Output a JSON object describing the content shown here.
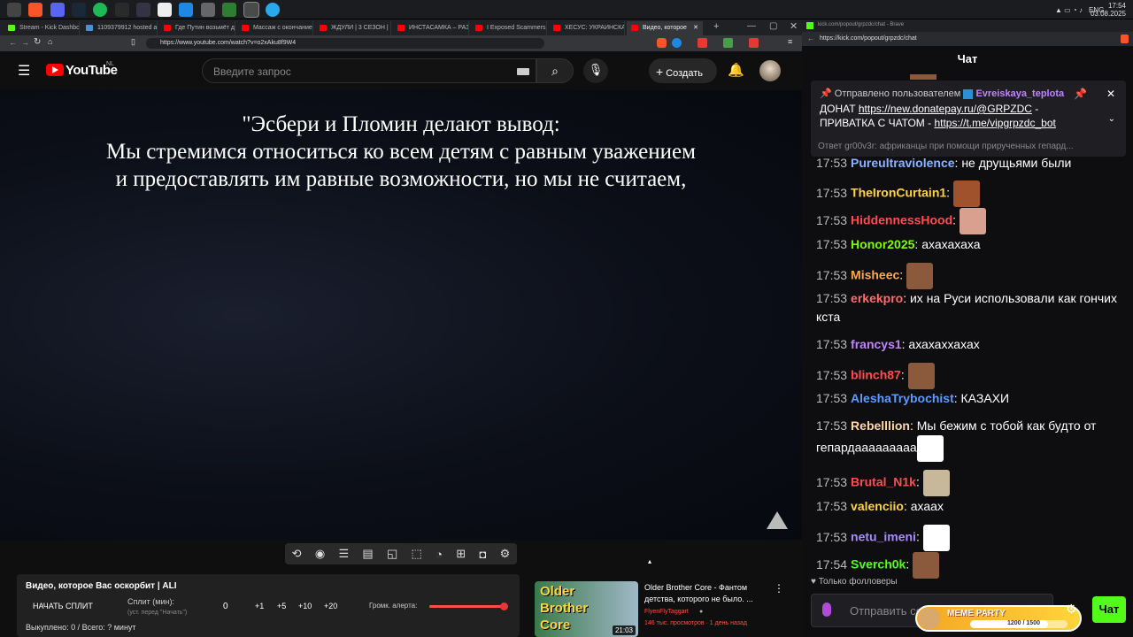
{
  "system": {
    "lang": "ENG",
    "time": "17:54",
    "date": "03.08.2025"
  },
  "browser_left": {
    "tabs": [
      {
        "label": "Stream - Kick Dashboard",
        "color": "#53fc18"
      },
      {
        "label": "1109379912 hosted at Im",
        "color": "#4a90d9"
      },
      {
        "label": "Где Путин возьмёт деньги",
        "color": "#ff0000"
      },
      {
        "label": "Массаж с окончанием",
        "color": "#ff0000"
      },
      {
        "label": "ЖДУЛИ | 3 СЕЗОН | 8 В",
        "color": "#ff0000"
      },
      {
        "label": "ИНСТАСАМКА – РАЗОБ",
        "color": "#ff0000"
      },
      {
        "label": "I Exposed Scammers in",
        "color": "#ff0000"
      },
      {
        "label": "ХЕСУС: УКРАИНСКАЯ (",
        "color": "#ff0000"
      },
      {
        "label": "Видео, которое",
        "color": "#ff0000"
      }
    ],
    "url": "https://www.youtube.com/watch?v=o2xAku8f9W4"
  },
  "youtube": {
    "logo": "YouTube",
    "region": "NL",
    "search_placeholder": "Введите запрос",
    "create_label": "Создать",
    "subtitles": [
      "\"Эсбери и Пломин делают вывод:",
      "Мы стремимся относиться ко всем детям с равным уважением",
      "и предоставлять им равные возможности, но мы не считаем,"
    ]
  },
  "alert_panel": {
    "title": "Видео, которое Вас оскорбит | ALI",
    "start_split": "НАЧАТЬ СПЛИТ",
    "split_label": "Сплит (мин):",
    "split_hint": "(уст. перед \"Начать\")",
    "split_value": "0",
    "increments": [
      "+1",
      "+5",
      "+10",
      "+20"
    ],
    "volume_label": "Громк. алерта:",
    "volume": 0.97,
    "bought": "Выкуплено: 0 / Всего: ? минут"
  },
  "recommendation": {
    "thumb_text": "Older Brother Core",
    "duration": "21:03",
    "title": "Older Brother Core - Фантом детства, которого не было. ...",
    "channel": "FlyenFlyTaggart",
    "meta": "146 тыс. просмотров · 1 день назад"
  },
  "browser_right": {
    "title": "kick.com/popout/grpzdc/chat - Brave",
    "url": "https://kick.com/popout/grpzdc/chat"
  },
  "chat": {
    "header": "Чат",
    "pinned": {
      "prefix": "Отправлено пользователем",
      "user": "Evreiskaya_teplota",
      "line1a": "ДОНАТ ",
      "link1": "https://new.donatepay.ru/@GRPZDC",
      "line1b": " -",
      "line2a": "ПРИВАТКА С ЧАТОМ - ",
      "link2": "https://t.me/vipgrpzdc_bot"
    },
    "reply_preview": "Ответ gr00v3r: африканцы при помощи прирученных гепард...",
    "messages": [
      {
        "time": "17:53",
        "user": "Pureultraviolence",
        "color": "#8ab4ff",
        "text": "не друщьями были",
        "emote": ""
      },
      {
        "time": "17:53",
        "user": "TheIronCurtain1",
        "color": "#ffd43b",
        "text": "",
        "emote": "#a0522d"
      },
      {
        "time": "17:53",
        "user": "HiddennessHood",
        "color": "#ff4d4d",
        "text": "",
        "emote": "#d9a090"
      },
      {
        "time": "17:53",
        "user": "Honor2025",
        "color": "#7cfc00",
        "text": "ахахахаха",
        "emote": ""
      },
      {
        "time": "17:53",
        "user": "Misheec",
        "color": "#ffa94d",
        "text": "",
        "emote": "#8b5a3c"
      },
      {
        "time": "17:53",
        "user": "erkekpro",
        "color": "#ff6b6b",
        "text": "их на Руси использовали как гончих кста",
        "emote": ""
      },
      {
        "time": "17:53",
        "user": "francys1",
        "color": "#c084fc",
        "text": "ахахаххахах",
        "emote": ""
      },
      {
        "time": "17:53",
        "user": "blinch87",
        "color": "#ff4d4d",
        "text": "",
        "emote": "#8b5a3c"
      },
      {
        "time": "17:53",
        "user": "AleshaTrybochist",
        "color": "#5b9bff",
        "text": "КАЗАХИ",
        "emote": ""
      },
      {
        "time": "17:53",
        "user": "Rebelllion",
        "color": "#ffd8a8",
        "text": "Мы бежим с тобой как будто от гепардааааааааа",
        "emote": "#ffffff"
      },
      {
        "time": "17:53",
        "user": "Brutal_N1k",
        "color": "#ff4d4d",
        "text": "",
        "emote": "#c8b89a"
      },
      {
        "time": "17:53",
        "user": "valenciio",
        "color": "#ffd43b",
        "text": "ахаах",
        "emote": ""
      },
      {
        "time": "17:53",
        "user": "netu_imeni",
        "color": "#a78bfa",
        "text": "",
        "emote": "#ffffff"
      },
      {
        "time": "17:54",
        "user": "Sverch0k",
        "color": "#53fc18",
        "text": "",
        "emote": "#8b5a3c"
      }
    ],
    "followers_only": "Только фолловеры",
    "input_placeholder": "Отправить со",
    "meme_party": "MEME PARTY",
    "meme_progress": "1200 / 1500",
    "meme_fill": 0.8,
    "send_label": "Чат"
  }
}
